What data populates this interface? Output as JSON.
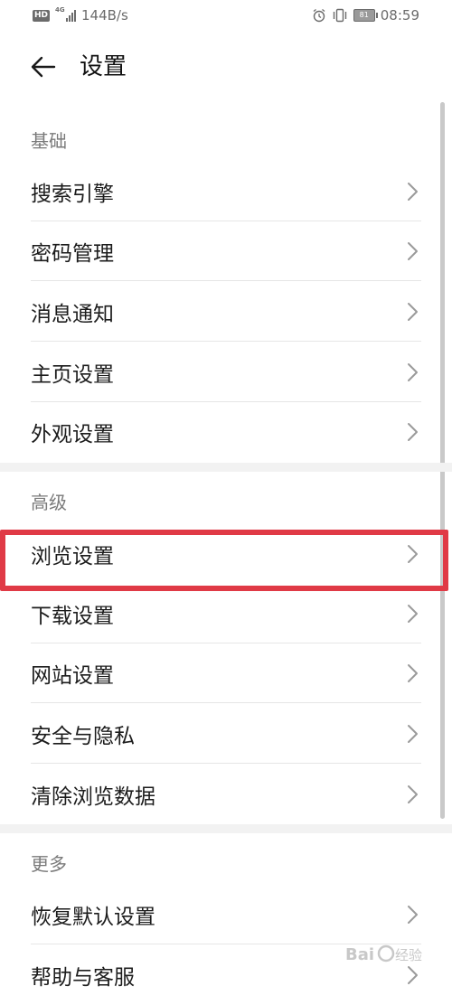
{
  "status_bar": {
    "hd": "HD",
    "network": "4G",
    "speed": "144B/s",
    "battery": "81",
    "time": "08:59",
    "icons": [
      "alarm-icon",
      "vibrate-icon",
      "battery-icon"
    ]
  },
  "header": {
    "title": "设置",
    "back_icon": "arrow-left-icon"
  },
  "sections": [
    {
      "title": "基础",
      "items": [
        {
          "label": "搜索引擎"
        },
        {
          "label": "密码管理"
        },
        {
          "label": "消息通知"
        },
        {
          "label": "主页设置"
        },
        {
          "label": "外观设置"
        }
      ]
    },
    {
      "title": "高级",
      "items": [
        {
          "label": "浏览设置"
        },
        {
          "label": "下载设置"
        },
        {
          "label": "网站设置"
        },
        {
          "label": "安全与隐私"
        },
        {
          "label": "清除浏览数据"
        }
      ]
    },
    {
      "title": "更多",
      "items": [
        {
          "label": "恢复默认设置"
        },
        {
          "label": "帮助与客服"
        }
      ]
    }
  ],
  "highlight": {
    "color": "#e03a46",
    "target": "浏览设置"
  },
  "watermark": {
    "text": "Baidu 经验"
  }
}
